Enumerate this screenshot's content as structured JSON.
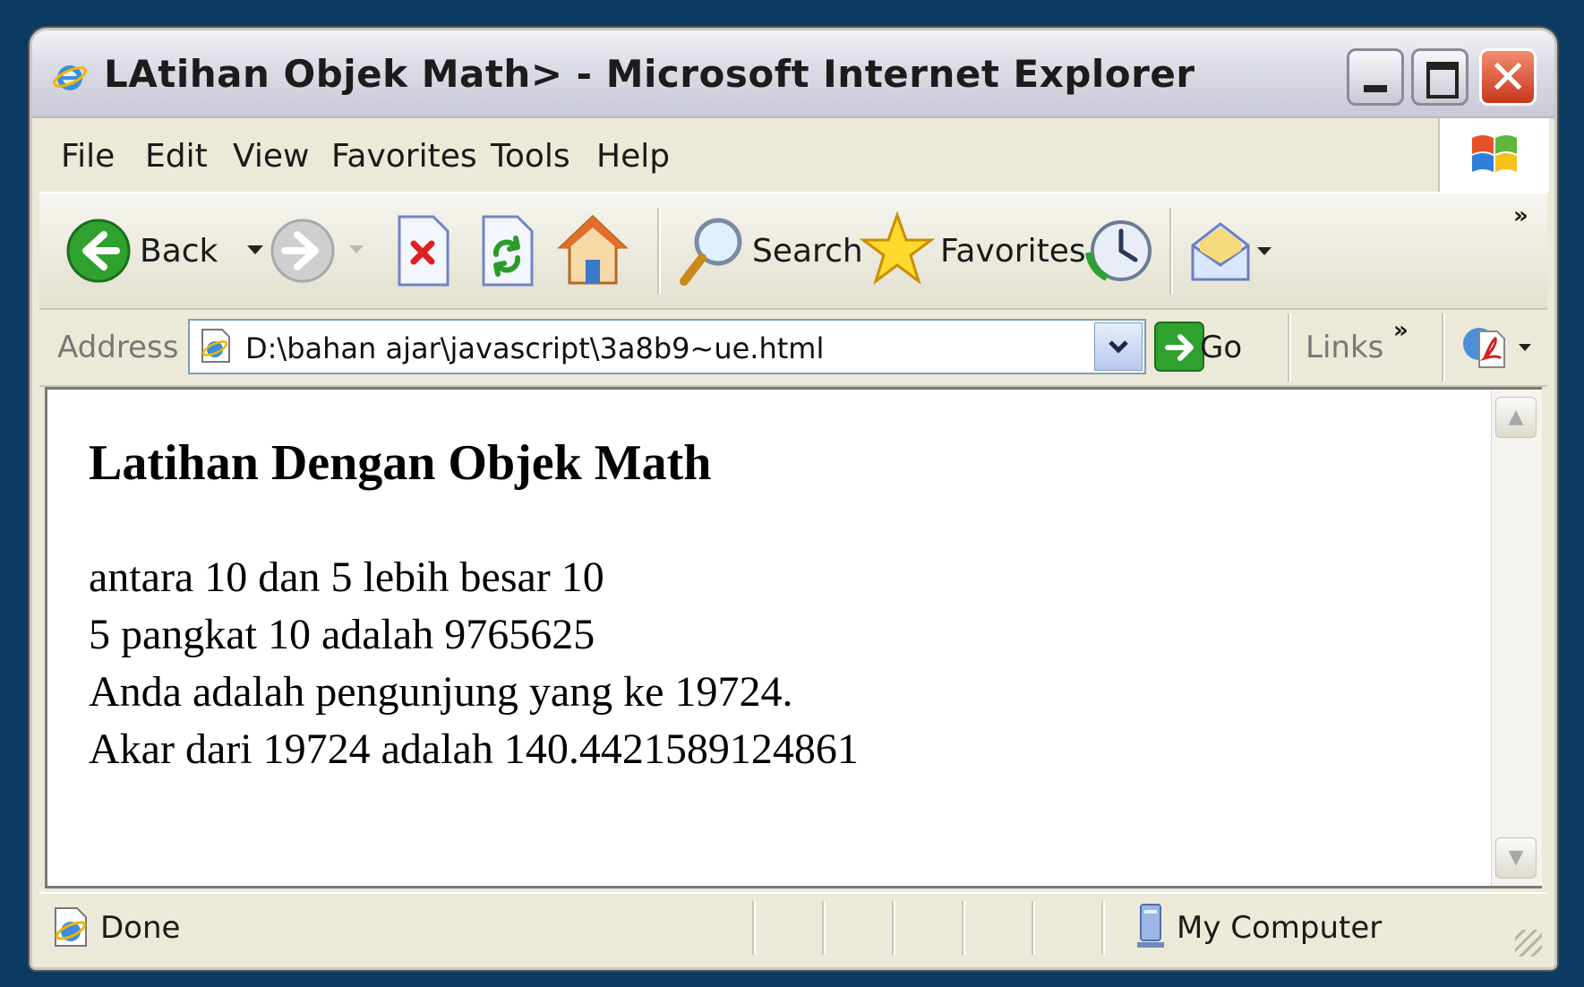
{
  "window": {
    "title": "LAtihan Objek Math> - Microsoft Internet Explorer"
  },
  "menu": {
    "items": [
      {
        "label": "File"
      },
      {
        "label": "Edit"
      },
      {
        "label": "View"
      },
      {
        "label": "Favorites"
      },
      {
        "label": "Tools"
      },
      {
        "label": "Help"
      }
    ]
  },
  "toolbar": {
    "back_label": "Back",
    "search_label": "Search",
    "favorites_label": "Favorites",
    "more_label": "»"
  },
  "address": {
    "label": "Address",
    "value": "D:\\bahan ajar\\javascript\\3a8b9~ue.html",
    "go_label": "Go",
    "links_label": "Links",
    "links_more": "»"
  },
  "page": {
    "heading": "Latihan Dengan Objek Math",
    "lines": [
      "antara 10 dan 5 lebih besar 10",
      "5 pangkat 10 adalah 9765625",
      "Anda adalah pengunjung yang ke 19724.",
      "Akar dari 19724 adalah 140.4421589124861"
    ]
  },
  "status": {
    "text": "Done",
    "zone": "My Computer"
  },
  "colors": {
    "desktop": "#0b3a63",
    "chrome": "#ece9d8",
    "close_button": "#c7371f"
  }
}
